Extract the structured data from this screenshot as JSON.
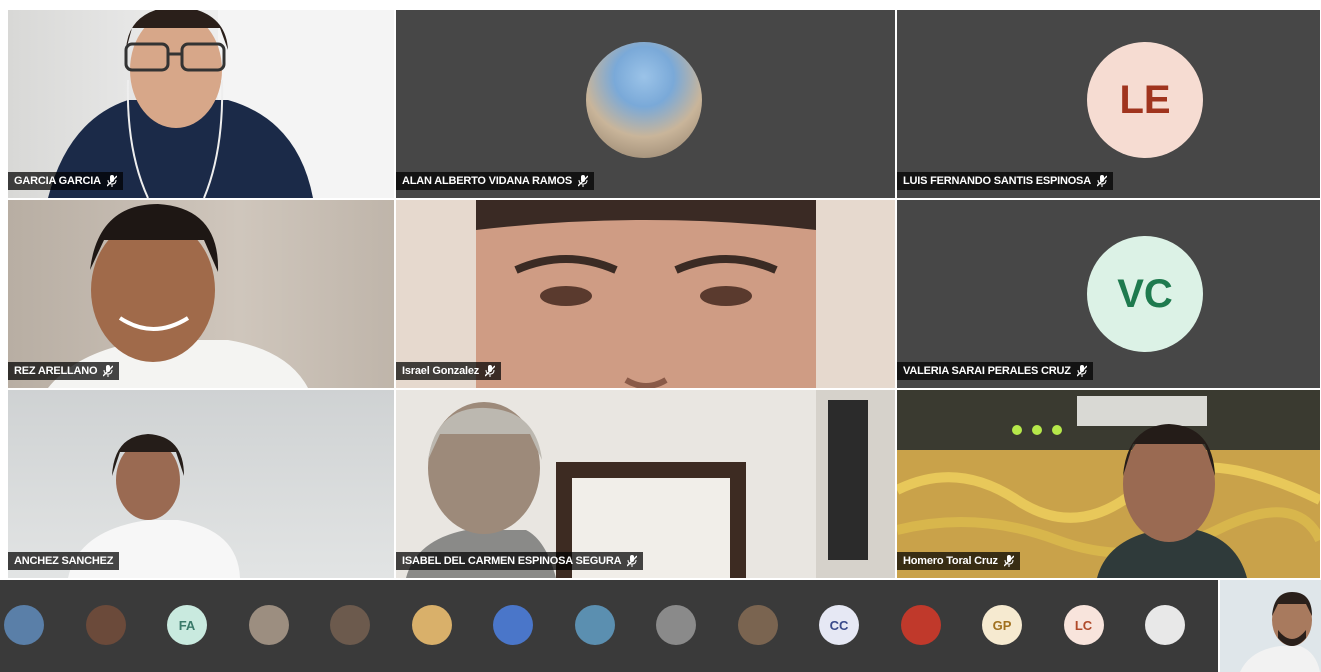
{
  "participants": [
    {
      "name": "GARCIA GARCIA",
      "initials": ""
    },
    {
      "name": "ALAN ALBERTO VIDANA RAMOS",
      "initials": ""
    },
    {
      "name": "LUIS FERNANDO SANTIS ESPINOSA",
      "initials": "LE"
    },
    {
      "name": "REZ ARELLANO",
      "initials": ""
    },
    {
      "name": "Israel Gonzalez",
      "initials": ""
    },
    {
      "name": "VALERIA SARAI PERALES CRUZ",
      "initials": "VC"
    },
    {
      "name": "ANCHEZ SANCHEZ",
      "initials": ""
    },
    {
      "name": "ISABEL DEL CARMEN ESPINOSA SEGURA",
      "initials": ""
    },
    {
      "name": "Homero Toral Cruz",
      "initials": ""
    }
  ],
  "strip": [
    {
      "initials": "",
      "color": "#5a7fa8"
    },
    {
      "initials": "",
      "color": "#6b4a3a"
    },
    {
      "initials": "FA",
      "color": "#c9eadf"
    },
    {
      "initials": "",
      "color": "#9c8e80"
    },
    {
      "initials": "",
      "color": "#6c5a4d"
    },
    {
      "initials": "",
      "color": "#d9b06a"
    },
    {
      "initials": "",
      "color": "#4a76c9"
    },
    {
      "initials": "",
      "color": "#5b8fb0"
    },
    {
      "initials": "",
      "color": "#8a8a8a"
    },
    {
      "initials": "",
      "color": "#7a6450"
    },
    {
      "initials": "CC",
      "color": "#e6e8f4"
    },
    {
      "initials": "",
      "color": "#c0392b"
    },
    {
      "initials": "GP",
      "color": "#f6ead0"
    },
    {
      "initials": "LC",
      "color": "#f8e4dc"
    },
    {
      "initials": "",
      "color": "#e8e8e8"
    }
  ]
}
